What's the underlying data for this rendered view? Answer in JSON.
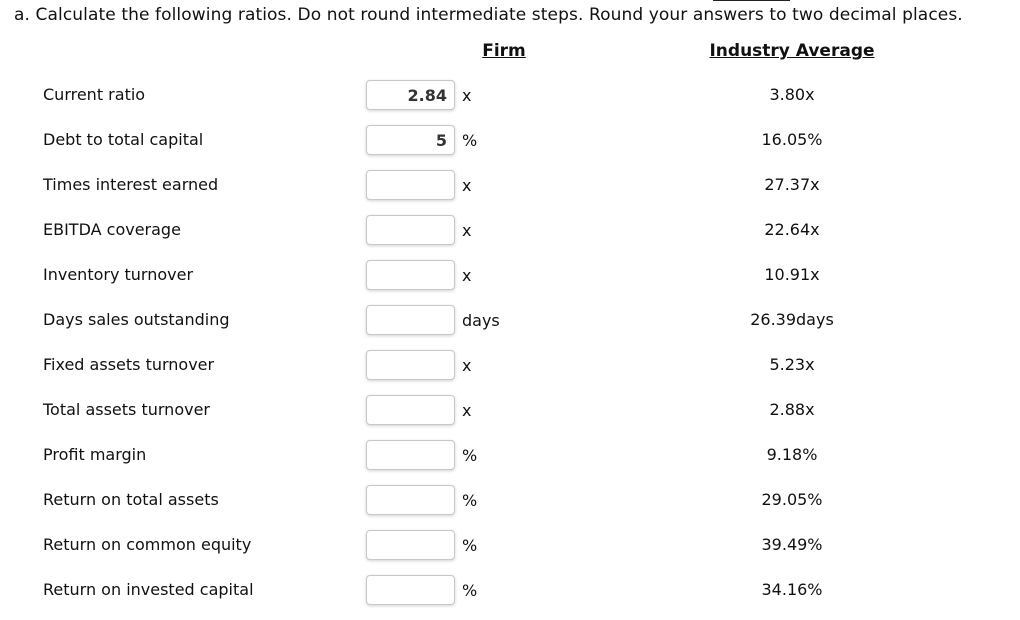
{
  "instruction": "a. Calculate the following ratios. Do not round intermediate steps. Round your answers to two decimal places.",
  "headers": {
    "firm": "Firm",
    "industry": "Industry Average"
  },
  "rows": [
    {
      "label": "Current ratio",
      "firm_value": "2.84",
      "unit": "x",
      "industry": "3.80x"
    },
    {
      "label": "Debt to total capital",
      "firm_value": "5",
      "unit": "%",
      "industry": "16.05%"
    },
    {
      "label": "Times interest earned",
      "firm_value": "",
      "unit": "x",
      "industry": "27.37x"
    },
    {
      "label": "EBITDA coverage",
      "firm_value": "",
      "unit": "x",
      "industry": "22.64x"
    },
    {
      "label": "Inventory turnover",
      "firm_value": "",
      "unit": "x",
      "industry": "10.91x"
    },
    {
      "label": "Days sales outstanding",
      "firm_value": "",
      "unit": "days",
      "industry": "26.39days"
    },
    {
      "label": "Fixed assets turnover",
      "firm_value": "",
      "unit": "x",
      "industry": "5.23x"
    },
    {
      "label": "Total assets turnover",
      "firm_value": "",
      "unit": "x",
      "industry": "2.88x"
    },
    {
      "label": "Profit margin",
      "firm_value": "",
      "unit": "%",
      "industry": "9.18%"
    },
    {
      "label": "Return on total assets",
      "firm_value": "",
      "unit": "%",
      "industry": "29.05%"
    },
    {
      "label": "Return on common equity",
      "firm_value": "",
      "unit": "%",
      "industry": "39.49%"
    },
    {
      "label": "Return on invested capital",
      "firm_value": "",
      "unit": "%",
      "industry": "34.16%"
    }
  ]
}
